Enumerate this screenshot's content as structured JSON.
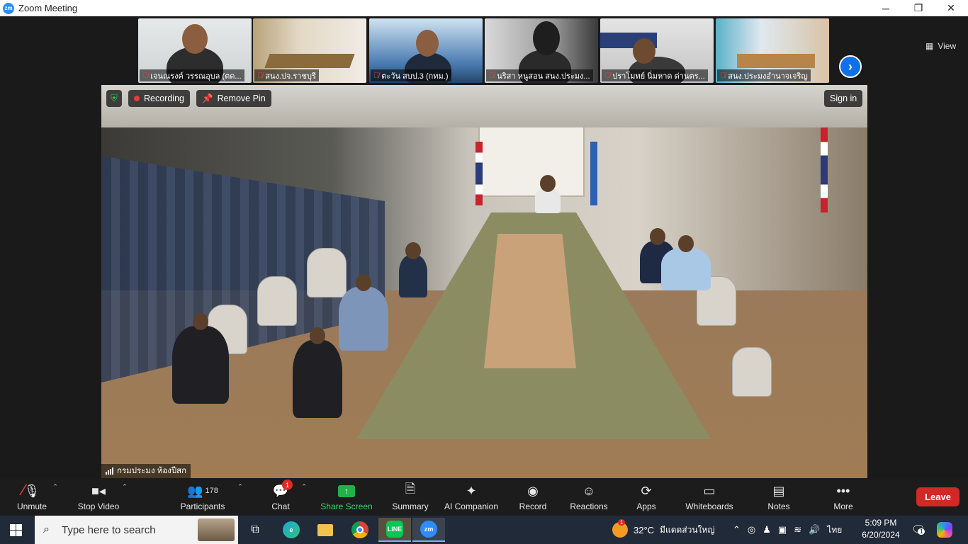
{
  "window": {
    "app_logo": "zm",
    "title": "Zoom Meeting",
    "controls": [
      "minimize",
      "restore",
      "close"
    ]
  },
  "gallery": {
    "tiles": [
      {
        "name": "เจนณรงค์ วรรณอุบล (ตด..."
      },
      {
        "name": "สนง.ปจ.ราชบุรี"
      },
      {
        "name": "ตะวัน สบป.3 (กทม.)"
      },
      {
        "name": "นริสา หนูสอน สนง.ประมง..."
      },
      {
        "name": "ปราโมทย์ นิ่มหาด ด่านตร..."
      },
      {
        "name": "สนง.ประมงอำนาจเจริญ"
      }
    ],
    "view_label": "View",
    "next_icon": "chevron-right-icon"
  },
  "main": {
    "recording_label": "Recording",
    "remove_pin_label": "Remove Pin",
    "sign_in_label": "Sign in",
    "speaker_name": "กรมประมง ห้องปีสก"
  },
  "toolbar": {
    "unmute": "Unmute",
    "stop_video": "Stop Video",
    "participants": "Participants",
    "participants_count": "178",
    "chat": "Chat",
    "chat_badge": "1",
    "share_screen": "Share Screen",
    "summary": "Summary",
    "ai_companion": "AI Companion",
    "record": "Record",
    "reactions": "Reactions",
    "apps": "Apps",
    "whiteboards": "Whiteboards",
    "notes": "Notes",
    "more": "More",
    "leave": "Leave"
  },
  "taskbar": {
    "search_placeholder": "Type here to search",
    "weather_temp": "32°C",
    "weather_desc": "มีแดดส่วนใหญ่",
    "weather_badge": "1",
    "language": "ไทย",
    "time": "5:09 PM",
    "date": "6/20/2024",
    "notification_count": "1",
    "apps": [
      "task-view",
      "edge",
      "file-explorer",
      "chrome",
      "line",
      "zoom"
    ]
  },
  "colors": {
    "zoom_blue": "#2D8CFF",
    "share_green": "#21B24C",
    "leave_red": "#D12828",
    "record_red": "#E23C3C",
    "taskbar": "#202A38",
    "toolbar_bg": "#1C1C1C"
  }
}
